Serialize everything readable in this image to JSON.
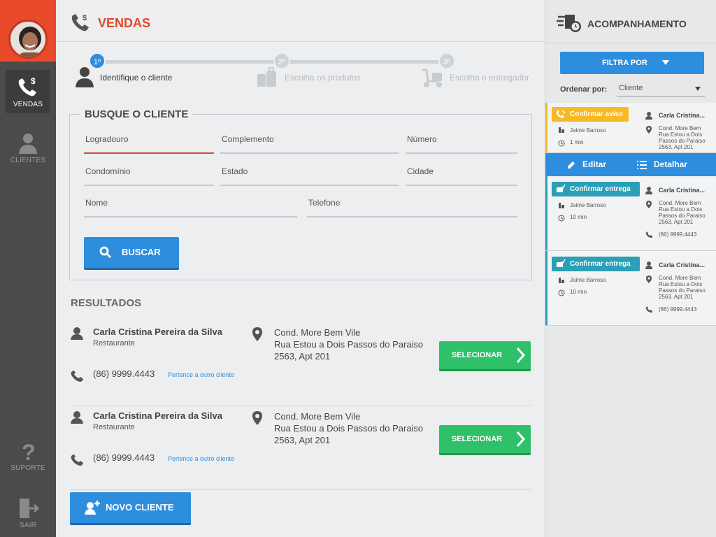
{
  "nav": {
    "items": [
      {
        "label": "VENDAS"
      },
      {
        "label": "CLIENTES"
      },
      {
        "label": "SUPORTE"
      },
      {
        "label": "SAIR"
      }
    ]
  },
  "header": {
    "title": "VENDAS"
  },
  "stepper": {
    "steps": [
      {
        "number": "1º",
        "label": "Identifique o cliente"
      },
      {
        "number": "2º",
        "label": "Escolha os produtos"
      },
      {
        "number": "3º",
        "label": "Escolha o entregador"
      }
    ]
  },
  "search": {
    "title": "BUSQUE O CLIENTE",
    "fields": {
      "logradouro": "Logradouro",
      "complemento": "Complemento",
      "numero": "Número",
      "condominio": "Condomínio",
      "estado": "Estado",
      "cidade": "Cidade",
      "nome": "Nome",
      "telefone": "Telefone"
    },
    "button": "BUSCAR"
  },
  "results": {
    "title": "RESULTADOS",
    "items": [
      {
        "name": "Carla Cristina Pereira da Silva",
        "type": "Restaurante",
        "phone": "(86) 9999.4443",
        "note": "Pertence a outro cliente",
        "address1": "Cond. More Bem Vile",
        "address2": "Rua Estou a Dois Passos do Paraiso",
        "address3": "2563, Apt 201",
        "button": "SELECIONAR"
      },
      {
        "name": "Carla Cristina Pereira da Silva",
        "type": "Restaurante",
        "phone": "(86) 9999.4443",
        "note": "Pertence a outro cliente",
        "address1": "Cond. More Bem Vile",
        "address2": "Rua Estou a Dois Passos do Paraiso",
        "address3": "2563, Apt 201",
        "button": "SELECIONAR"
      }
    ],
    "new_client_button": "NOVO CLIENTE"
  },
  "tracking": {
    "title": "ACOMPANHAMENTO",
    "filter_button": "FILTRA POR",
    "sort_label": "Ordenar por:",
    "sort_value": "Cliente",
    "actions": {
      "edit": "Editar",
      "detail": "Detalhar"
    },
    "colors": {
      "warning": "#f7b924",
      "delivery": "#2a9fb5",
      "accent": "#2e8ede"
    },
    "cards": [
      {
        "status": "Confirmar aviso",
        "courier": "Jaime Barroso",
        "time": "1 min",
        "client": "Carla Cristina...",
        "addr1": "Cond. More Bem",
        "addr2": "Rua Estou a Dois",
        "addr3": "Passos do Paraiso",
        "addr4": "2563, Apt 201"
      },
      {
        "status": "Confirmar entrega",
        "courier": "Jaime Barroso",
        "time": "10 min",
        "client": "Carla Cristina...",
        "addr1": "Cond. More Bem",
        "addr2": "Rua Estou a Dois",
        "addr3": "Passos do Paraiso",
        "addr4": "2563, Apt 201",
        "phone": "(86) 9999.4443"
      },
      {
        "status": "Confirmar entrega",
        "courier": "Jaime Barroso",
        "time": "10 min",
        "client": "Carla Cristina...",
        "addr1": "Cond. More Bem",
        "addr2": "Rua Estou a Dois",
        "addr3": "Passos do Paraiso",
        "addr4": "2563, Apt 201",
        "phone": "(86) 9999.4443"
      }
    ]
  }
}
